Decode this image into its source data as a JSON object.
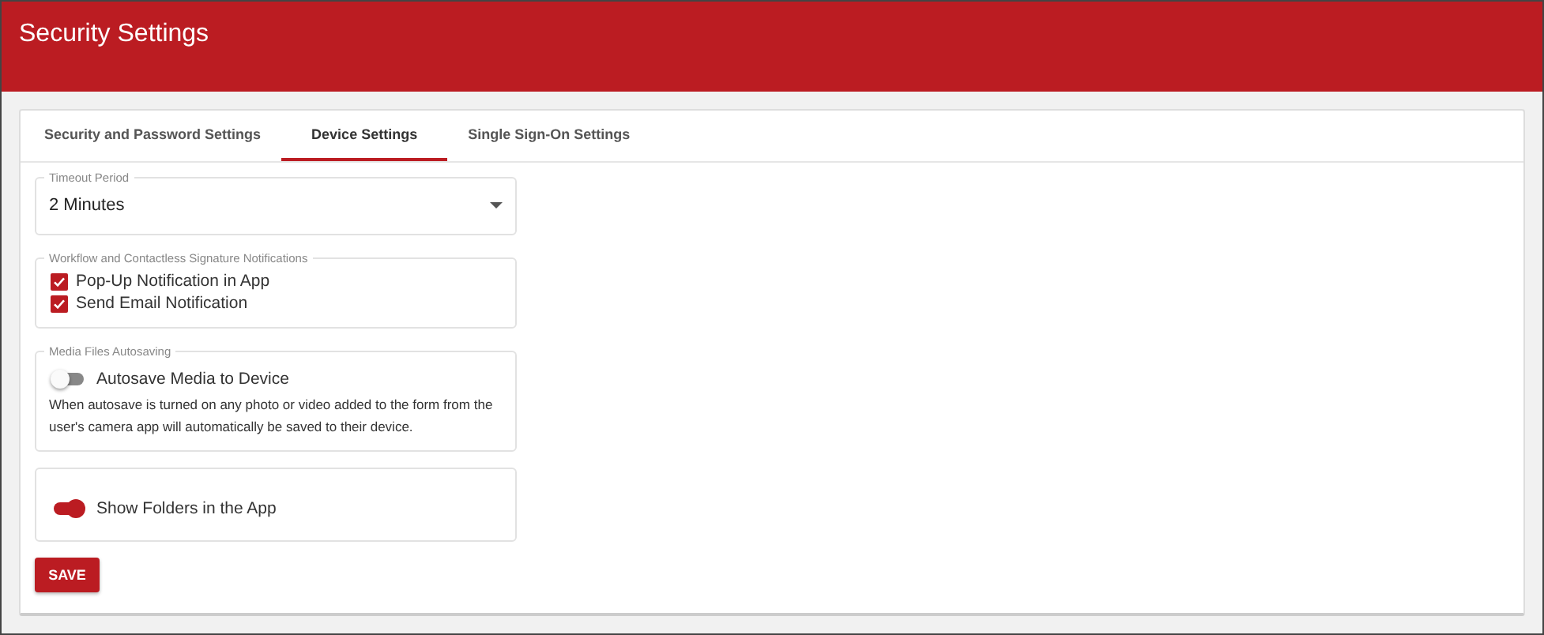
{
  "header": {
    "title": "Security Settings"
  },
  "tabs": [
    {
      "label": "Security and Password Settings",
      "selected": false
    },
    {
      "label": "Device Settings",
      "selected": true
    },
    {
      "label": "Single Sign-On Settings",
      "selected": false
    }
  ],
  "sections": [
    {
      "kind": "select",
      "legend": "Timeout Period",
      "value": "2 Minutes"
    },
    {
      "kind": "checkboxes",
      "legend": "Workflow and Contactless Signature Notifications",
      "items": [
        {
          "label": "Pop-Up Notification in App",
          "checked": true
        },
        {
          "label": "Send Email Notification",
          "checked": true
        }
      ]
    },
    {
      "kind": "toggle",
      "legend": "Media Files Autosaving",
      "label": "Autosave Media to Device",
      "on": false,
      "description": "When autosave is turned on any photo or video added to the form from the user's camera app will automatically be saved to their device."
    },
    {
      "kind": "toggle",
      "label": "Show Folders in the App",
      "on": true
    }
  ],
  "save_button": "SAVE"
}
